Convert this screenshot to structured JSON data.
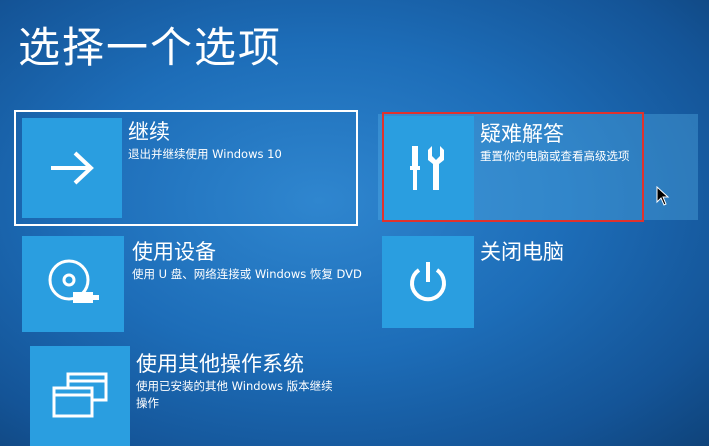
{
  "page": {
    "title": "选择一个选项"
  },
  "options": {
    "continue": {
      "title": "继续",
      "desc": "退出并继续使用 Windows 10",
      "icon": "arrow-right-icon"
    },
    "use_device": {
      "title": "使用设备",
      "desc": "使用 U 盘、网络连接或 Windows 恢复 DVD",
      "icon": "disc-usb-icon"
    },
    "other_os": {
      "title": "使用其他操作系统",
      "desc": "使用已安装的其他 Windows 版本继续操作",
      "icon": "windows-stack-icon"
    },
    "troubleshoot": {
      "title": "疑难解答",
      "desc": "重置你的电脑或查看高级选项",
      "icon": "tools-icon"
    },
    "shutdown": {
      "title": "关闭电脑",
      "icon": "power-icon"
    }
  },
  "colors": {
    "background": "#1d6db8",
    "tile": "#2a9ee0",
    "highlight": "#e0322d",
    "text": "#ffffff"
  }
}
